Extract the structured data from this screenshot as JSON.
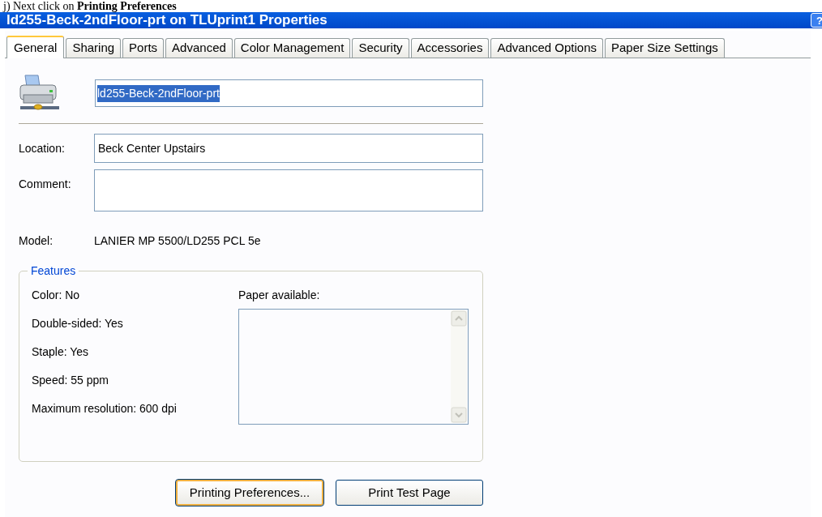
{
  "document_heading": "j) Next click on **Printing Preferences**",
  "window": {
    "title": "ld255-Beck-2ndFloor-prt on TLUprint1 Properties",
    "help_button": "?"
  },
  "tabs": [
    {
      "label": "General",
      "selected": true
    },
    {
      "label": "Sharing",
      "selected": false
    },
    {
      "label": "Ports",
      "selected": false
    },
    {
      "label": "Advanced",
      "selected": false
    },
    {
      "label": "Color Management",
      "selected": false
    },
    {
      "label": "Security",
      "selected": false
    },
    {
      "label": "Accessories",
      "selected": false
    },
    {
      "label": "Advanced Options",
      "selected": false
    },
    {
      "label": "Paper Size Settings",
      "selected": false
    }
  ],
  "printer_name": {
    "value": "ld255-Beck-2ndFloor-prt",
    "text_selected": true
  },
  "fields": [
    {
      "label": "Location:",
      "value": "Beck Center Upstairs",
      "kind": "single"
    },
    {
      "label": "Comment:",
      "kind": "multi"
    }
  ],
  "model": {
    "label": "Model:",
    "value": "LANIER MP 5500/LD255 PCL 5e"
  },
  "features": {
    "title": "Features",
    "items": [
      "Color: No",
      "Double-sided: Yes",
      "Staple: Yes",
      "Speed: 55 ppm",
      "Maximum resolution: 600 dpi"
    ],
    "paper_label": "Paper available:"
  },
  "buttons": [
    {
      "label": "Printing Preferences...",
      "focused": true
    },
    {
      "label": "Print Test Page",
      "focused": false
    }
  ]
}
